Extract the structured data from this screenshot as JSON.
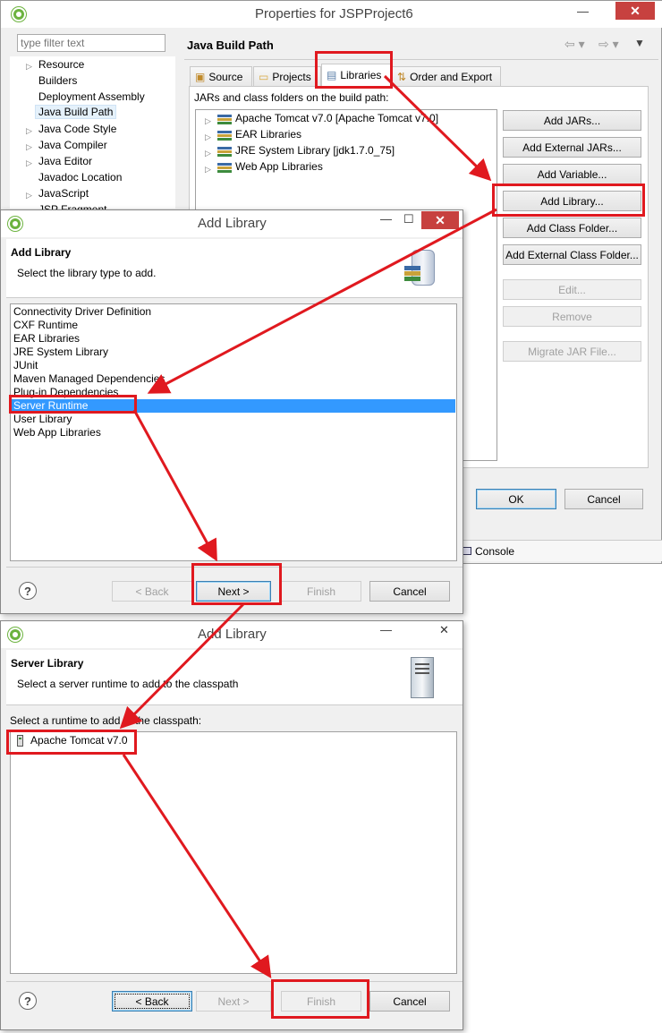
{
  "properties": {
    "title": "Properties for JSPProject6",
    "filter_placeholder": "type filter text",
    "nav_items": [
      "Resource",
      "Builders",
      "Deployment Assembly",
      "Java Build Path",
      "Java Code Style",
      "Java Compiler",
      "Java Editor",
      "Javadoc Location",
      "JavaScript",
      "JSP Fragment"
    ],
    "section_title": "Java Build Path",
    "tabs": [
      "Source",
      "Projects",
      "Libraries",
      "Order and Export"
    ],
    "jars_label": "JARs and class folders on the build path:",
    "libraries": [
      "Apache Tomcat v7.0 [Apache Tomcat v7.0]",
      "EAR Libraries",
      "JRE System Library [jdk1.7.0_75]",
      "Web App Libraries"
    ],
    "buttons": {
      "add_jars": "Add JARs...",
      "add_external_jars": "Add External JARs...",
      "add_variable": "Add Variable...",
      "add_library": "Add Library...",
      "add_class_folder": "Add Class Folder...",
      "add_external_class_folder": "Add External Class Folder...",
      "edit": "Edit...",
      "remove": "Remove",
      "migrate": "Migrate JAR File...",
      "ok": "OK",
      "cancel": "Cancel"
    },
    "console_tab": "Console"
  },
  "add_library_1": {
    "title": "Add Library",
    "banner_title": "Add Library",
    "banner_desc": "Select the library type to add.",
    "types": [
      "Connectivity Driver Definition",
      "CXF Runtime",
      "EAR Libraries",
      "JRE System Library",
      "JUnit",
      "Maven Managed Dependencies",
      "Plug-in Dependencies",
      "Server Runtime",
      "User Library",
      "Web App Libraries"
    ],
    "selected_type": "Server Runtime",
    "buttons": {
      "back": "< Back",
      "next": "Next >",
      "finish": "Finish",
      "cancel": "Cancel"
    }
  },
  "add_library_2": {
    "title": "Add Library",
    "banner_title": "Server Library",
    "banner_desc": "Select a server runtime to add to the classpath",
    "runtime_label": "Select a runtime to add to the classpath:",
    "runtimes": [
      "Apache Tomcat v7.0"
    ],
    "buttons": {
      "back": "< Back",
      "next": "Next >",
      "finish": "Finish",
      "cancel": "Cancel"
    }
  },
  "colors": {
    "annotation_red": "#e0191f",
    "selection_blue": "#3399ff",
    "eclipse_green": "#6cb33f"
  }
}
